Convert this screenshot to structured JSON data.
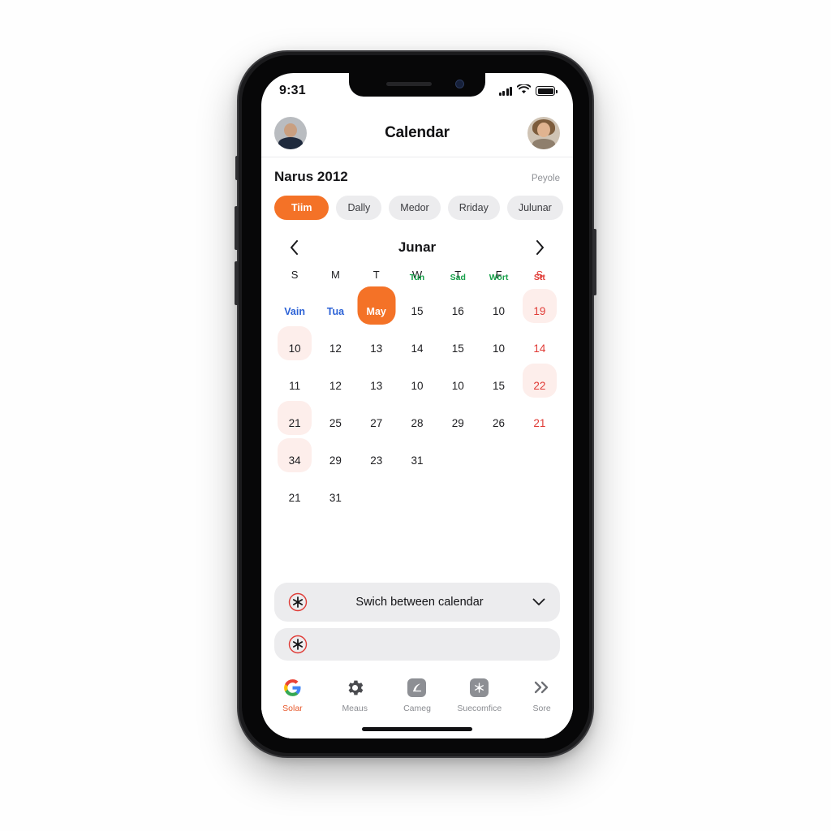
{
  "status_bar": {
    "time": "9:31",
    "signal_icon": "signal-bars-icon",
    "wifi_icon": "wifi-icon",
    "battery_icon": "battery-icon"
  },
  "header": {
    "title": "Calendar",
    "left_avatar": "user-avatar-left",
    "right_avatar": "user-avatar-right"
  },
  "section": {
    "title": "Narus 2012",
    "action": "Peyole"
  },
  "chips": [
    {
      "label": "Tiim",
      "active": true
    },
    {
      "label": "Dally",
      "active": false
    },
    {
      "label": "Medor",
      "active": false
    },
    {
      "label": "Rriday",
      "active": false
    },
    {
      "label": "Julunar",
      "active": false
    }
  ],
  "month_nav": {
    "prev_icon": "chevron-left-icon",
    "label": "Junar",
    "next_icon": "chevron-right-icon"
  },
  "weekdays": [
    {
      "label": "S",
      "sunday": false
    },
    {
      "label": "M",
      "sunday": false
    },
    {
      "label": "T",
      "sunday": false
    },
    {
      "label": "W",
      "sunday": false
    },
    {
      "label": "T",
      "sunday": false
    },
    {
      "label": "F",
      "sunday": false
    },
    {
      "label": "S",
      "sunday": true
    }
  ],
  "calendar_rows": [
    [
      {
        "num": "Vain",
        "style": "blue"
      },
      {
        "num": "Tua",
        "style": "blue"
      },
      {
        "num": "May",
        "style": "selected"
      },
      {
        "num": "15",
        "style": "",
        "tag": "Tun",
        "tag_color": "green"
      },
      {
        "num": "16",
        "style": "",
        "tag": "Sad",
        "tag_color": "green"
      },
      {
        "num": "10",
        "style": "",
        "tag": "Wort",
        "tag_color": "green"
      },
      {
        "num": "19",
        "style": "red pinkbg",
        "tag": "Stt",
        "tag_color": "red"
      }
    ],
    [
      {
        "num": "10",
        "style": "pinkbg"
      },
      {
        "num": "12",
        "style": ""
      },
      {
        "num": "13",
        "style": ""
      },
      {
        "num": "14",
        "style": ""
      },
      {
        "num": "15",
        "style": ""
      },
      {
        "num": "10",
        "style": ""
      },
      {
        "num": "14",
        "style": "red"
      }
    ],
    [
      {
        "num": "11",
        "style": ""
      },
      {
        "num": "12",
        "style": ""
      },
      {
        "num": "13",
        "style": ""
      },
      {
        "num": "10",
        "style": ""
      },
      {
        "num": "10",
        "style": ""
      },
      {
        "num": "15",
        "style": ""
      },
      {
        "num": "22",
        "style": "red pinkbg"
      }
    ],
    [
      {
        "num": "21",
        "style": "pinkbg"
      },
      {
        "num": "25",
        "style": ""
      },
      {
        "num": "27",
        "style": ""
      },
      {
        "num": "28",
        "style": ""
      },
      {
        "num": "29",
        "style": ""
      },
      {
        "num": "26",
        "style": ""
      },
      {
        "num": "21",
        "style": "red"
      }
    ],
    [
      {
        "num": "34",
        "style": "pinkbg"
      },
      {
        "num": "29",
        "style": ""
      },
      {
        "num": "23",
        "style": ""
      },
      {
        "num": "31",
        "style": ""
      },
      {
        "num": "",
        "style": ""
      },
      {
        "num": "",
        "style": ""
      },
      {
        "num": "",
        "style": ""
      }
    ],
    [
      {
        "num": "21",
        "style": ""
      },
      {
        "num": "31",
        "style": ""
      },
      {
        "num": "",
        "style": ""
      },
      {
        "num": "",
        "style": ""
      },
      {
        "num": "",
        "style": ""
      },
      {
        "num": "",
        "style": ""
      },
      {
        "num": "",
        "style": ""
      }
    ]
  ],
  "option_cards": [
    {
      "label": "Swich between calendar",
      "icon": "asterisk-circle-icon",
      "chevron": "chevron-down-icon"
    },
    {
      "label": "",
      "icon": "partial-card-icon",
      "chevron": ""
    }
  ],
  "tabs": [
    {
      "label": "Solar",
      "icon": "google-g-icon",
      "active": true
    },
    {
      "label": "Meaus",
      "icon": "gear-icon",
      "active": false
    },
    {
      "label": "Cameg",
      "icon": "square-leaf-icon",
      "active": false
    },
    {
      "label": "Suecomfice",
      "icon": "square-star-icon",
      "active": false
    },
    {
      "label": "Sore",
      "icon": "double-chevron-right-icon",
      "active": false
    }
  ],
  "colors": {
    "accent_orange": "#f47227",
    "sunday_red": "#e03a35",
    "event_green": "#17a04a",
    "link_blue": "#2c62d6",
    "chip_grey": "#ececee",
    "pink_highlight": "#fdeeeb"
  }
}
